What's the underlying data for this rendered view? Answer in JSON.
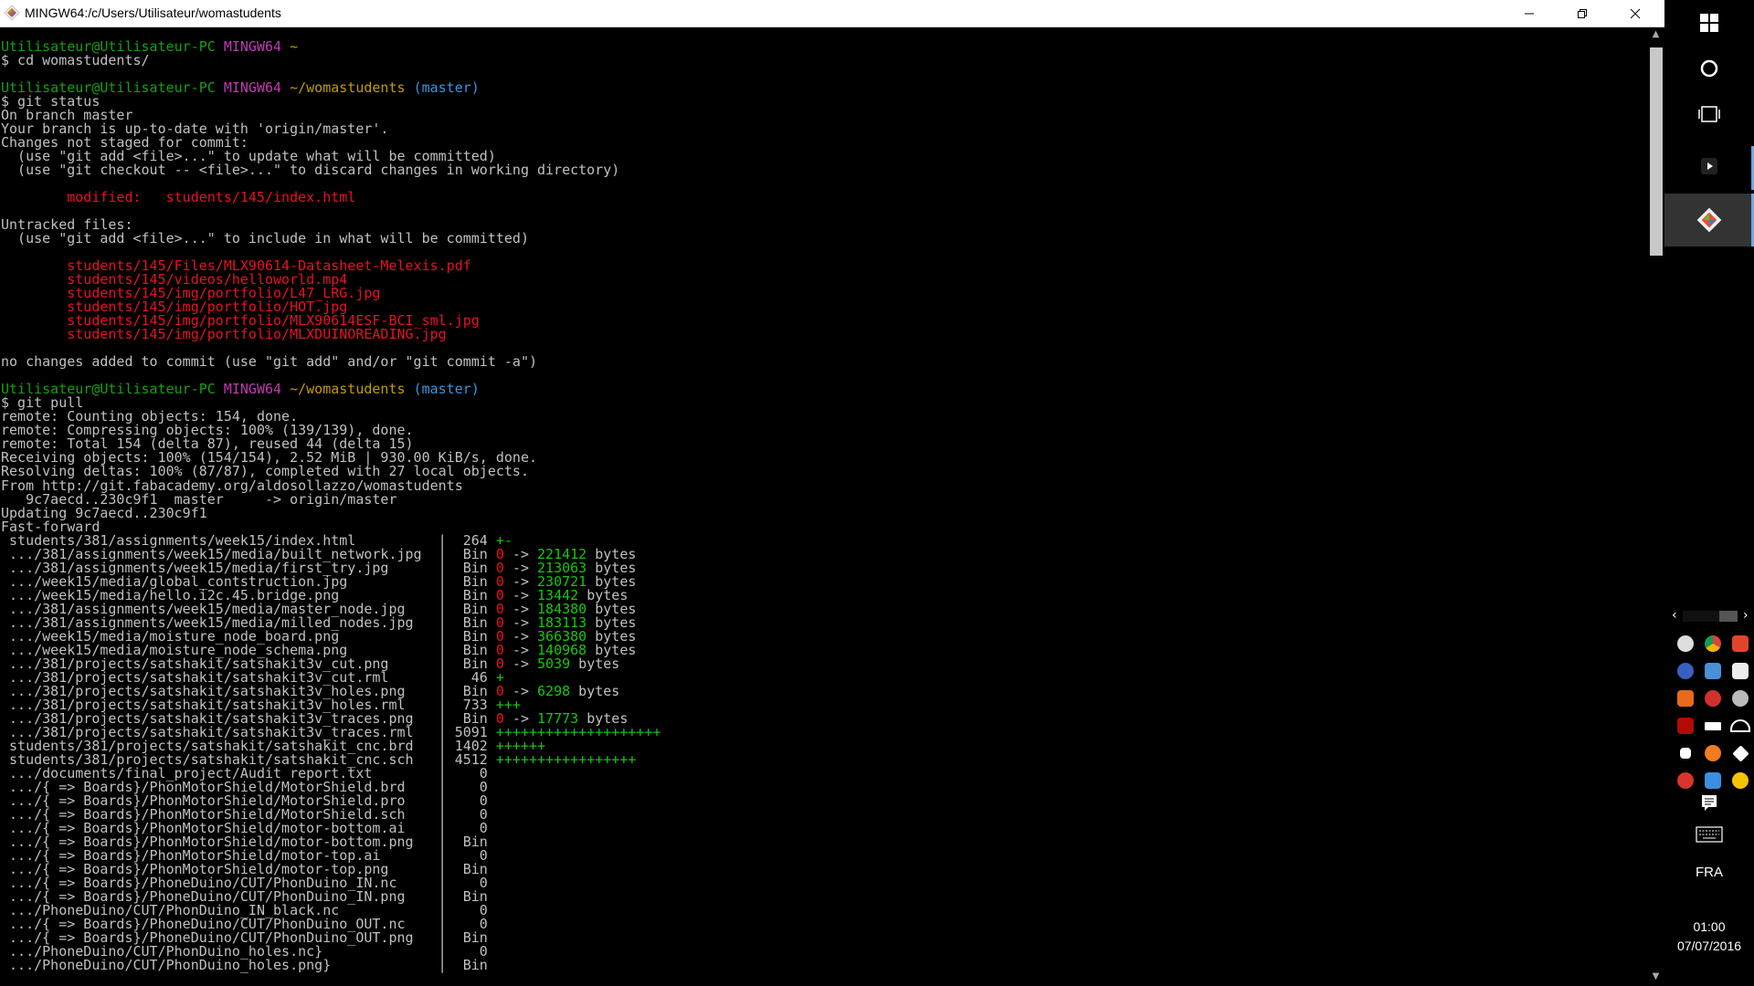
{
  "window": {
    "title": "MINGW64:/c/Users/Utilisateur/womastudents",
    "minimize_icon": "minimize-icon",
    "restore_icon": "restore-icon",
    "close_icon": "close-icon"
  },
  "colors": {
    "default": "#c0c0c0",
    "green": "#13a10e",
    "magenta": "#c239b3",
    "yellow": "#c19c00",
    "cyan": "#3a96dd",
    "red": "#e81123",
    "brightgreen": "#16c60c"
  },
  "terminal": {
    "lines": [
      [
        {
          "t": "Utilisateur@Utilisateur-PC ",
          "c": "green"
        },
        {
          "t": "MINGW64 ",
          "c": "magenta"
        },
        {
          "t": "~",
          "c": "yellow"
        }
      ],
      [
        {
          "t": "$ cd womastudents/",
          "c": "default"
        }
      ],
      [
        {
          "t": "",
          "c": "default"
        }
      ],
      [
        {
          "t": "Utilisateur@Utilisateur-PC ",
          "c": "green"
        },
        {
          "t": "MINGW64 ",
          "c": "magenta"
        },
        {
          "t": "~/womastudents ",
          "c": "yellow"
        },
        {
          "t": "(master)",
          "c": "cyan"
        }
      ],
      [
        {
          "t": "$ git status",
          "c": "default"
        }
      ],
      [
        {
          "t": "On branch master",
          "c": "default"
        }
      ],
      [
        {
          "t": "Your branch is up-to-date with 'origin/master'.",
          "c": "default"
        }
      ],
      [
        {
          "t": "Changes not staged for commit:",
          "c": "default"
        }
      ],
      [
        {
          "t": "  (use \"git add <file>...\" to update what will be committed)",
          "c": "default"
        }
      ],
      [
        {
          "t": "  (use \"git checkout -- <file>...\" to discard changes in working directory)",
          "c": "default"
        }
      ],
      [
        {
          "t": "",
          "c": "default"
        }
      ],
      [
        {
          "t": "        modified:   students/145/index.html",
          "c": "red"
        }
      ],
      [
        {
          "t": "",
          "c": "default"
        }
      ],
      [
        {
          "t": "Untracked files:",
          "c": "default"
        }
      ],
      [
        {
          "t": "  (use \"git add <file>...\" to include in what will be committed)",
          "c": "default"
        }
      ],
      [
        {
          "t": "",
          "c": "default"
        }
      ],
      [
        {
          "t": "        students/145/Files/MLX90614-Datasheet-Melexis.pdf",
          "c": "red"
        }
      ],
      [
        {
          "t": "        students/145/videos/helloworld.mp4",
          "c": "red"
        }
      ],
      [
        {
          "t": "        students/145/img/portfolio/L47_LRG.jpg",
          "c": "red"
        }
      ],
      [
        {
          "t": "        students/145/img/portfolio/HOT.jpg",
          "c": "red"
        }
      ],
      [
        {
          "t": "        students/145/img/portfolio/MLX90614ESF-BCI_sml.jpg",
          "c": "red"
        }
      ],
      [
        {
          "t": "        students/145/img/portfolio/MLXDUINOREADING.jpg",
          "c": "red"
        }
      ],
      [
        {
          "t": "",
          "c": "default"
        }
      ],
      [
        {
          "t": "no changes added to commit (use \"git add\" and/or \"git commit -a\")",
          "c": "default"
        }
      ],
      [
        {
          "t": "",
          "c": "default"
        }
      ],
      [
        {
          "t": "Utilisateur@Utilisateur-PC ",
          "c": "green"
        },
        {
          "t": "MINGW64 ",
          "c": "magenta"
        },
        {
          "t": "~/womastudents ",
          "c": "yellow"
        },
        {
          "t": "(master)",
          "c": "cyan"
        }
      ],
      [
        {
          "t": "$ git pull",
          "c": "default"
        }
      ],
      [
        {
          "t": "remote: Counting objects: 154, done.",
          "c": "default"
        }
      ],
      [
        {
          "t": "remote: Compressing objects: 100% (139/139), done.",
          "c": "default"
        }
      ],
      [
        {
          "t": "remote: Total 154 (delta 87), reused 44 (delta 15)",
          "c": "default"
        }
      ],
      [
        {
          "t": "Receiving objects: 100% (154/154), 2.52 MiB | 930.00 KiB/s, done.",
          "c": "default"
        }
      ],
      [
        {
          "t": "Resolving deltas: 100% (87/87), completed with 27 local objects.",
          "c": "default"
        }
      ],
      [
        {
          "t": "From http://git.fabacademy.org/aldosollazzo/womastudents",
          "c": "default"
        }
      ],
      [
        {
          "t": "   9c7aecd..230c9f1  master     -> origin/master",
          "c": "default"
        }
      ],
      [
        {
          "t": "Updating 9c7aecd..230c9f1",
          "c": "default"
        }
      ],
      [
        {
          "t": "Fast-forward",
          "c": "default"
        }
      ],
      [
        {
          "t": " students/381/assignments/week15/index.html          |  264 ",
          "c": "default"
        },
        {
          "t": "+-",
          "c": "brightgreen"
        }
      ],
      [
        {
          "t": " .../381/assignments/week15/media/built_network.jpg  |  Bin ",
          "c": "default"
        },
        {
          "t": "0",
          "c": "red"
        },
        {
          "t": " -> ",
          "c": "default"
        },
        {
          "t": "221412",
          "c": "brightgreen"
        },
        {
          "t": " bytes",
          "c": "default"
        }
      ],
      [
        {
          "t": " .../381/assignments/week15/media/first_try.jpg      |  Bin ",
          "c": "default"
        },
        {
          "t": "0",
          "c": "red"
        },
        {
          "t": " -> ",
          "c": "default"
        },
        {
          "t": "213063",
          "c": "brightgreen"
        },
        {
          "t": " bytes",
          "c": "default"
        }
      ],
      [
        {
          "t": " .../week15/media/global_contstruction.jpg           |  Bin ",
          "c": "default"
        },
        {
          "t": "0",
          "c": "red"
        },
        {
          "t": " -> ",
          "c": "default"
        },
        {
          "t": "230721",
          "c": "brightgreen"
        },
        {
          "t": " bytes",
          "c": "default"
        }
      ],
      [
        {
          "t": " .../week15/media/hello.i2c.45.bridge.png            |  Bin ",
          "c": "default"
        },
        {
          "t": "0",
          "c": "red"
        },
        {
          "t": " -> ",
          "c": "default"
        },
        {
          "t": "13442",
          "c": "brightgreen"
        },
        {
          "t": " bytes",
          "c": "default"
        }
      ],
      [
        {
          "t": " .../381/assignments/week15/media/master_node.jpg    |  Bin ",
          "c": "default"
        },
        {
          "t": "0",
          "c": "red"
        },
        {
          "t": " -> ",
          "c": "default"
        },
        {
          "t": "184380",
          "c": "brightgreen"
        },
        {
          "t": " bytes",
          "c": "default"
        }
      ],
      [
        {
          "t": " .../381/assignments/week15/media/milled_nodes.jpg   |  Bin ",
          "c": "default"
        },
        {
          "t": "0",
          "c": "red"
        },
        {
          "t": " -> ",
          "c": "default"
        },
        {
          "t": "183113",
          "c": "brightgreen"
        },
        {
          "t": " bytes",
          "c": "default"
        }
      ],
      [
        {
          "t": " .../week15/media/moisture_node_board.png            |  Bin ",
          "c": "default"
        },
        {
          "t": "0",
          "c": "red"
        },
        {
          "t": " -> ",
          "c": "default"
        },
        {
          "t": "366380",
          "c": "brightgreen"
        },
        {
          "t": " bytes",
          "c": "default"
        }
      ],
      [
        {
          "t": " .../week15/media/moisture_node_schema.png           |  Bin ",
          "c": "default"
        },
        {
          "t": "0",
          "c": "red"
        },
        {
          "t": " -> ",
          "c": "default"
        },
        {
          "t": "140968",
          "c": "brightgreen"
        },
        {
          "t": " bytes",
          "c": "default"
        }
      ],
      [
        {
          "t": " .../381/projects/satshakit/satshakit3v_cut.png      |  Bin ",
          "c": "default"
        },
        {
          "t": "0",
          "c": "red"
        },
        {
          "t": " -> ",
          "c": "default"
        },
        {
          "t": "5039",
          "c": "brightgreen"
        },
        {
          "t": " bytes",
          "c": "default"
        }
      ],
      [
        {
          "t": " .../381/projects/satshakit/satshakit3v_cut.rml      |   46 ",
          "c": "default"
        },
        {
          "t": "+",
          "c": "brightgreen"
        }
      ],
      [
        {
          "t": " .../381/projects/satshakit/satshakit3v_holes.png    |  Bin ",
          "c": "default"
        },
        {
          "t": "0",
          "c": "red"
        },
        {
          "t": " -> ",
          "c": "default"
        },
        {
          "t": "6298",
          "c": "brightgreen"
        },
        {
          "t": " bytes",
          "c": "default"
        }
      ],
      [
        {
          "t": " .../381/projects/satshakit/satshakit3v_holes.rml    |  733 ",
          "c": "default"
        },
        {
          "t": "+++",
          "c": "brightgreen"
        }
      ],
      [
        {
          "t": " .../381/projects/satshakit/satshakit3v_traces.png   |  Bin ",
          "c": "default"
        },
        {
          "t": "0",
          "c": "red"
        },
        {
          "t": " -> ",
          "c": "default"
        },
        {
          "t": "17773",
          "c": "brightgreen"
        },
        {
          "t": " bytes",
          "c": "default"
        }
      ],
      [
        {
          "t": " .../381/projects/satshakit/satshakit3v_traces.rml   | 5091 ",
          "c": "default"
        },
        {
          "t": "++++++++++++++++++++",
          "c": "brightgreen"
        }
      ],
      [
        {
          "t": " students/381/projects/satshakit/satshakit_cnc.brd   | 1402 ",
          "c": "default"
        },
        {
          "t": "++++++",
          "c": "brightgreen"
        }
      ],
      [
        {
          "t": " students/381/projects/satshakit/satshakit_cnc.sch   | 4512 ",
          "c": "default"
        },
        {
          "t": "+++++++++++++++++",
          "c": "brightgreen"
        }
      ],
      [
        {
          "t": " .../documents/final_project/Audit report.txt        |    0",
          "c": "default"
        }
      ],
      [
        {
          "t": " .../{ => Boards}/PhonMotorShield/MotorShield.brd    |    0",
          "c": "default"
        }
      ],
      [
        {
          "t": " .../{ => Boards}/PhonMotorShield/MotorShield.pro    |    0",
          "c": "default"
        }
      ],
      [
        {
          "t": " .../{ => Boards}/PhonMotorShield/MotorShield.sch    |    0",
          "c": "default"
        }
      ],
      [
        {
          "t": " .../{ => Boards}/PhonMotorShield/motor-bottom.ai    |    0",
          "c": "default"
        }
      ],
      [
        {
          "t": " .../{ => Boards}/PhonMotorShield/motor-bottom.png   |  Bin",
          "c": "default"
        }
      ],
      [
        {
          "t": " .../{ => Boards}/PhonMotorShield/motor-top.ai       |    0",
          "c": "default"
        }
      ],
      [
        {
          "t": " .../{ => Boards}/PhonMotorShield/motor-top.png      |  Bin",
          "c": "default"
        }
      ],
      [
        {
          "t": " .../{ => Boards}/PhoneDuino/CUT/PhonDuino_IN.nc     |    0",
          "c": "default"
        }
      ],
      [
        {
          "t": " .../{ => Boards}/PhoneDuino/CUT/PhonDuino_IN.png    |  Bin",
          "c": "default"
        }
      ],
      [
        {
          "t": " .../PhoneDuino/CUT/PhonDuino_IN_black.nc            |    0",
          "c": "default"
        }
      ],
      [
        {
          "t": " .../{ => Boards}/PhoneDuino/CUT/PhonDuino_OUT.nc    |    0",
          "c": "default"
        }
      ],
      [
        {
          "t": " .../{ => Boards}/PhoneDuino/CUT/PhonDuino_OUT.png   |  Bin",
          "c": "default"
        }
      ],
      [
        {
          "t": " .../PhoneDuino/CUT/PhonDuino_holes.nc}              |    0",
          "c": "default"
        }
      ],
      [
        {
          "t": " .../PhoneDuino/CUT/PhonDuino_holes.png}             |  Bin",
          "c": "default"
        }
      ]
    ]
  },
  "sidepanel": {
    "icons": [
      "windows-logo-icon",
      "cortana-circle-icon",
      "task-view-icon",
      "play-icon",
      "git-app-icon"
    ]
  },
  "tray": {
    "icons": [
      [
        "pin-icon",
        "chrome-icon",
        "app-icon"
      ],
      [
        "cortana-icon",
        "tool-icon",
        "inkscape-icon"
      ],
      [
        "app-icon",
        "settings-icon",
        "cloud-icon"
      ],
      [
        "acrobat-icon",
        "battery-icon",
        "wifi-icon"
      ],
      [
        "volume-muted-icon",
        "avast-icon",
        "dropbox-icon"
      ],
      [
        "paint-icon",
        "image-icon",
        "lock-icon"
      ]
    ],
    "notification_icon": "notification-icon",
    "keyboard_icon": "keyboard-icon",
    "language": "FRA",
    "time": "01:00",
    "date": "07/07/2016"
  }
}
